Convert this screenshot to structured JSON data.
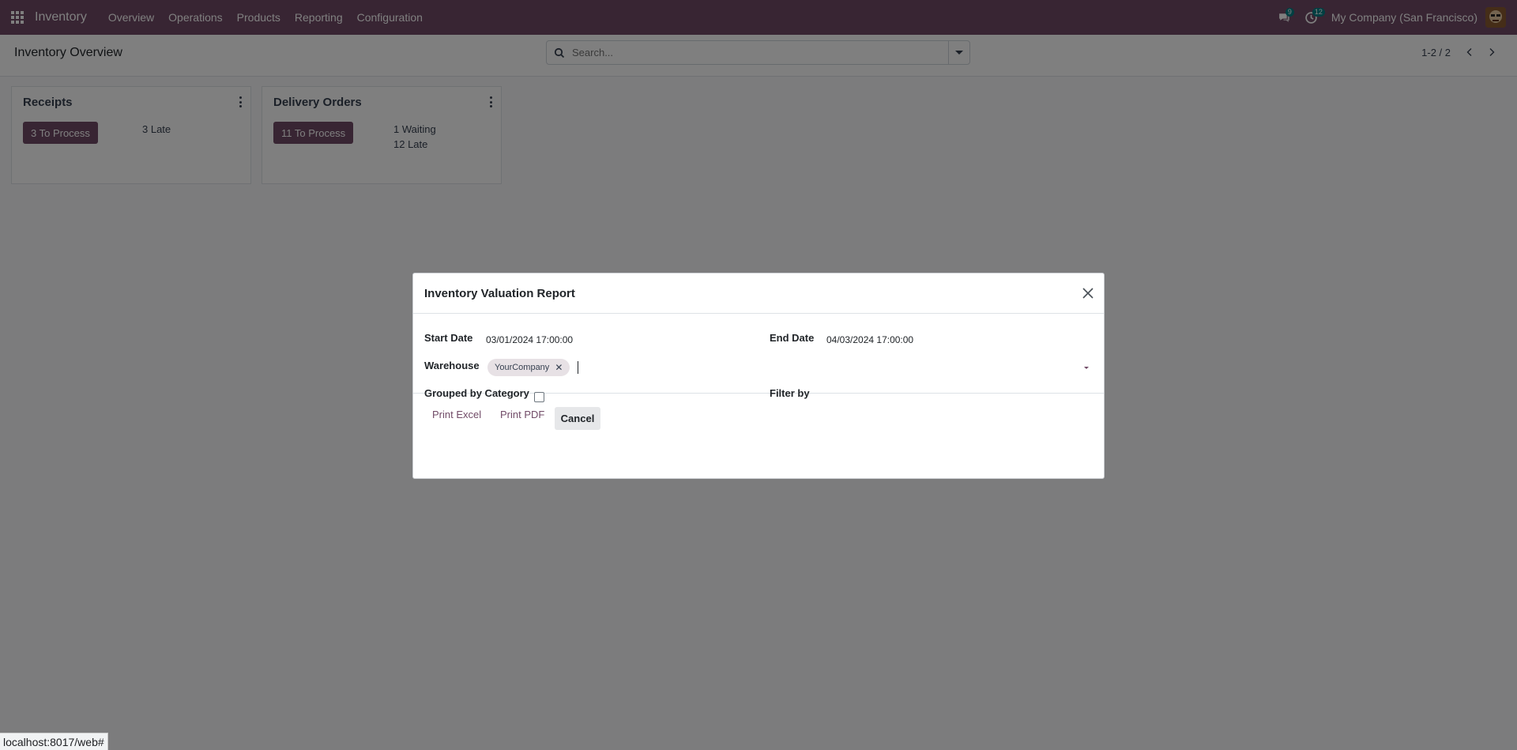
{
  "navbar": {
    "app_name": "Inventory",
    "menu": [
      "Overview",
      "Operations",
      "Products",
      "Reporting",
      "Configuration"
    ],
    "messages_count": "9",
    "activities_count": "12",
    "company": "My Company (San Francisco)",
    "accent": "#714b67"
  },
  "control_panel": {
    "breadcrumb": "Inventory Overview",
    "search_placeholder": "Search...",
    "pager": "1-2 / 2"
  },
  "cards": [
    {
      "title": "Receipts",
      "button": "3 To Process",
      "stats": [
        "3 Late"
      ]
    },
    {
      "title": "Delivery Orders",
      "button": "11 To Process",
      "stats": [
        "1 Waiting",
        "12 Late"
      ]
    }
  ],
  "modal": {
    "title": "Inventory Valuation Report",
    "start_date_label": "Start Date",
    "start_date_value": "03/01/2024 17:00:00",
    "end_date_label": "End Date",
    "end_date_value": "04/03/2024 17:00:00",
    "warehouse_label": "Warehouse",
    "warehouse_tag": "YourCompany",
    "grouped_label": "Grouped by Category",
    "grouped_checked": false,
    "filter_label": "Filter by",
    "print_excel": "Print Excel",
    "print_pdf": "Print PDF",
    "cancel": "Cancel"
  },
  "status_url": "localhost:8017/web#"
}
